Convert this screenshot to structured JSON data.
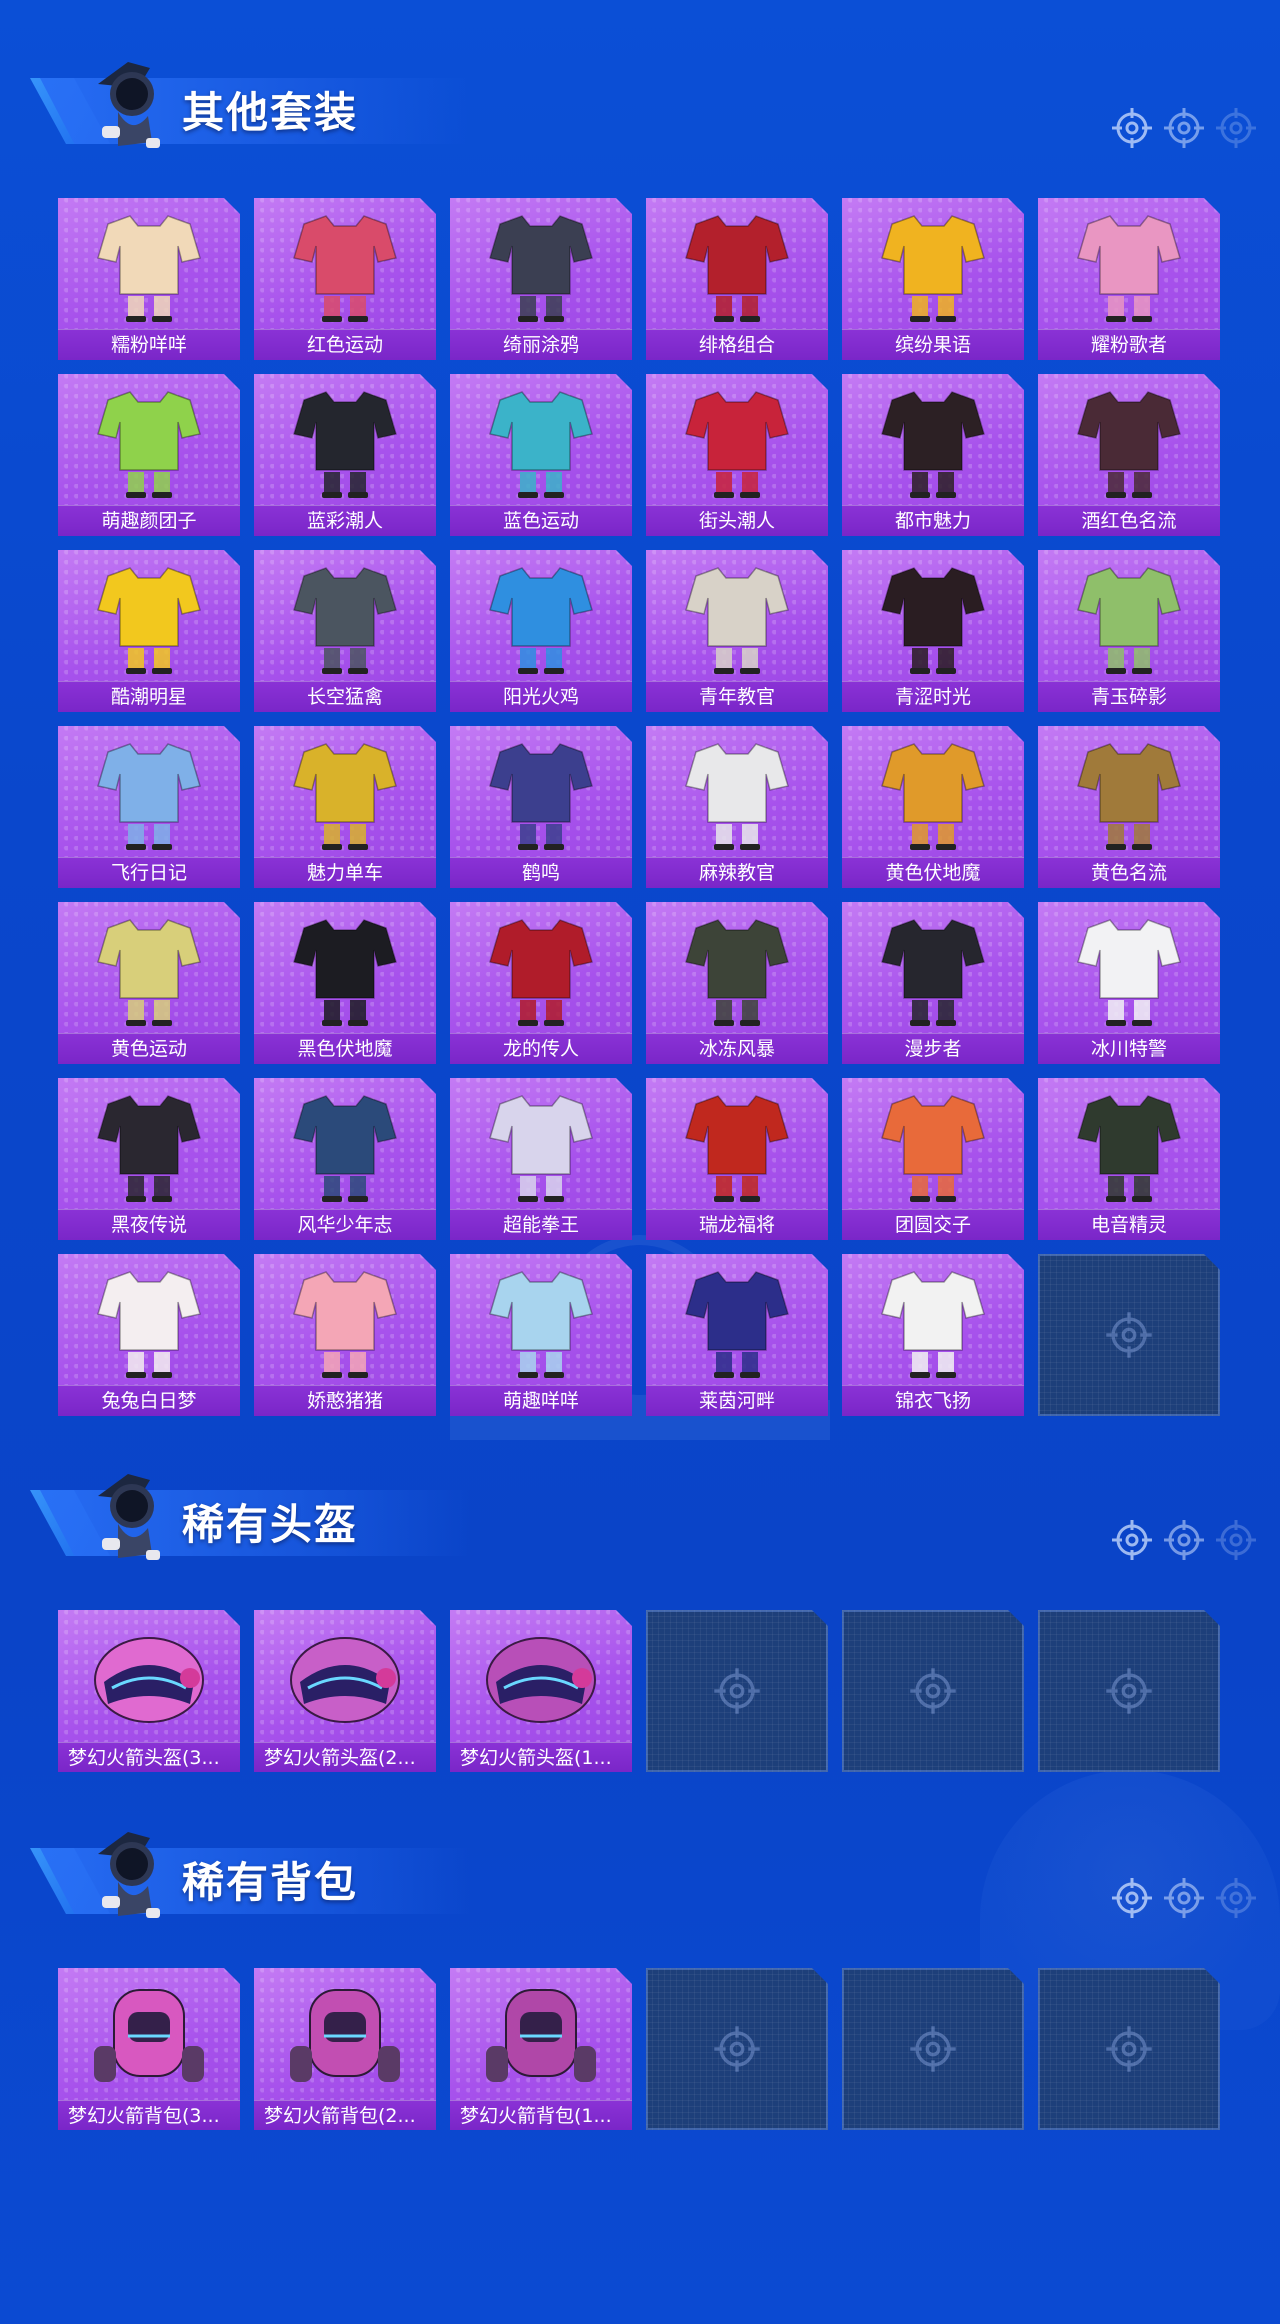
{
  "colors": {
    "background": "#0a47cc",
    "card_purple": "#a752ec",
    "label_purple": "#7a26c8",
    "empty_slot": "#1d3f7a",
    "title_text": "#ffffff"
  },
  "sections": [
    {
      "title": "其他套装",
      "items": [
        {
          "label": "糯粉咩咩",
          "icon": "outfit-icon",
          "tint": "#f1d9b8"
        },
        {
          "label": "红色运动",
          "icon": "outfit-icon",
          "tint": "#d94b6a"
        },
        {
          "label": "绮丽涂鸦",
          "icon": "outfit-icon",
          "tint": "#3b3f52"
        },
        {
          "label": "绯格组合",
          "icon": "outfit-icon",
          "tint": "#b3202c"
        },
        {
          "label": "缤纷果语",
          "icon": "outfit-icon",
          "tint": "#f0b320"
        },
        {
          "label": "耀粉歌者",
          "icon": "outfit-icon",
          "tint": "#e996c2"
        },
        {
          "label": "萌趣颜团子",
          "icon": "outfit-icon",
          "tint": "#8fd24b"
        },
        {
          "label": "蓝彩潮人",
          "icon": "outfit-icon",
          "tint": "#24262e"
        },
        {
          "label": "蓝色运动",
          "icon": "outfit-icon",
          "tint": "#3bb3c9"
        },
        {
          "label": "街头潮人",
          "icon": "outfit-icon",
          "tint": "#c8233a"
        },
        {
          "label": "都市魅力",
          "icon": "outfit-icon",
          "tint": "#2c2024"
        },
        {
          "label": "酒红色名流",
          "icon": "outfit-icon",
          "tint": "#4a2a36"
        },
        {
          "label": "酷潮明星",
          "icon": "outfit-icon",
          "tint": "#f2c81e"
        },
        {
          "label": "长空猛禽",
          "icon": "outfit-icon",
          "tint": "#4b5560"
        },
        {
          "label": "阳光火鸡",
          "icon": "outfit-icon",
          "tint": "#2f8fe0"
        },
        {
          "label": "青年教官",
          "icon": "outfit-icon",
          "tint": "#d8d2c8"
        },
        {
          "label": "青涩时光",
          "icon": "outfit-icon",
          "tint": "#2a1d22"
        },
        {
          "label": "青玉碎影",
          "icon": "outfit-icon",
          "tint": "#8fbf6a"
        },
        {
          "label": "飞行日记",
          "icon": "outfit-icon",
          "tint": "#7fb0e8"
        },
        {
          "label": "魅力单车",
          "icon": "outfit-icon",
          "tint": "#d9b22a"
        },
        {
          "label": "鹤鸣",
          "icon": "outfit-icon",
          "tint": "#3c3f8e"
        },
        {
          "label": "麻辣教官",
          "icon": "outfit-icon",
          "tint": "#e8e8ea"
        },
        {
          "label": "黄色伏地魔",
          "icon": "outfit-icon",
          "tint": "#e09a2a"
        },
        {
          "label": "黄色名流",
          "icon": "outfit-icon",
          "tint": "#a07a3a"
        },
        {
          "label": "黄色运动",
          "icon": "outfit-icon",
          "tint": "#d8cf7a"
        },
        {
          "label": "黑色伏地魔",
          "icon": "outfit-icon",
          "tint": "#1c1c22"
        },
        {
          "label": "龙的传人",
          "icon": "outfit-icon",
          "tint": "#b01c2a"
        },
        {
          "label": "冰冻风暴",
          "icon": "outfit-icon",
          "tint": "#3d4438"
        },
        {
          "label": "漫步者",
          "icon": "outfit-icon",
          "tint": "#26262e"
        },
        {
          "label": "冰川特警",
          "icon": "outfit-icon",
          "tint": "#f2f2f4"
        },
        {
          "label": "黑夜传说",
          "icon": "outfit-icon",
          "tint": "#2a2730"
        },
        {
          "label": "风华少年志",
          "icon": "outfit-icon",
          "tint": "#2b4a7a"
        },
        {
          "label": "超能拳王",
          "icon": "outfit-icon",
          "tint": "#d8d4ec"
        },
        {
          "label": "瑞龙福将",
          "icon": "outfit-icon",
          "tint": "#c0281e"
        },
        {
          "label": "团圆交子",
          "icon": "outfit-icon",
          "tint": "#e86a3a"
        },
        {
          "label": "电音精灵",
          "icon": "outfit-icon",
          "tint": "#2f3a2e"
        },
        {
          "label": "兔兔白日梦",
          "icon": "outfit-icon",
          "tint": "#f4eef0"
        },
        {
          "label": "娇憨猪猪",
          "icon": "outfit-icon",
          "tint": "#f4a6b6"
        },
        {
          "label": "萌趣咩咩",
          "icon": "outfit-icon",
          "tint": "#a8d4ee"
        },
        {
          "label": "莱茵河畔",
          "icon": "outfit-icon",
          "tint": "#2c2e8a"
        },
        {
          "label": "锦衣飞扬",
          "icon": "outfit-icon",
          "tint": "#f2f2f2"
        }
      ],
      "empty_slots": 1
    },
    {
      "title": "稀有头盔",
      "items": [
        {
          "label": "梦幻火箭头盔(3...",
          "icon": "helmet-icon",
          "tint": "#e06ad0"
        },
        {
          "label": "梦幻火箭头盔(2...",
          "icon": "helmet-icon",
          "tint": "#c85fc8"
        },
        {
          "label": "梦幻火箭头盔(1...",
          "icon": "helmet-icon",
          "tint": "#b84fb8"
        }
      ],
      "empty_slots": 3
    },
    {
      "title": "稀有背包",
      "items": [
        {
          "label": "梦幻火箭背包(3...",
          "icon": "backpack-icon",
          "tint": "#d858c0"
        },
        {
          "label": "梦幻火箭背包(2...",
          "icon": "backpack-icon",
          "tint": "#c24eb2"
        },
        {
          "label": "梦幻火箭背包(1...",
          "icon": "backpack-icon",
          "tint": "#b047a8"
        }
      ],
      "empty_slots": 3
    }
  ]
}
